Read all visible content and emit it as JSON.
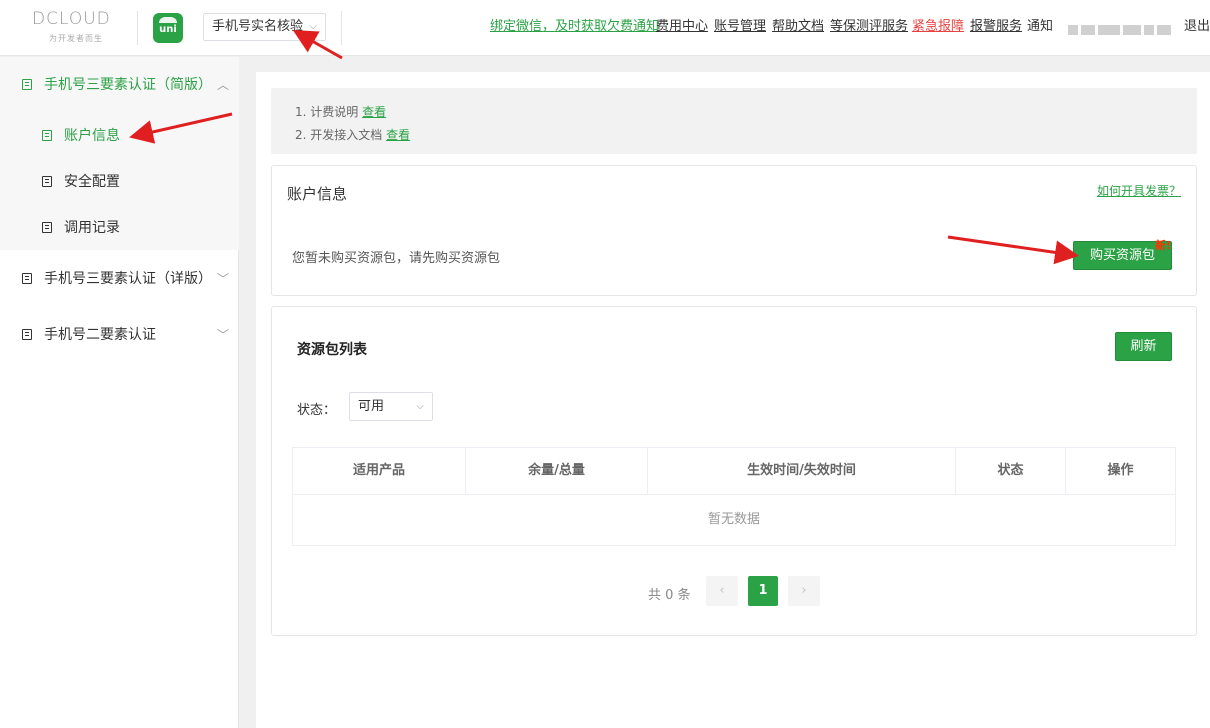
{
  "header": {
    "logo_text": "DCLOUD",
    "logo_sub": "为开发者而生",
    "uni_icon_label": "uni",
    "app_select": "手机号实名核验",
    "links": {
      "wechat": "绑定微信，及时获取欠费通知",
      "cost_center": "费用中心",
      "account_mgmt": "账号管理",
      "help_docs": "帮助文档",
      "security_eval": "等保测评服务",
      "emergency": "紧急报障",
      "alarm_service": "报警服务",
      "notice": "通知",
      "logout": "退出"
    }
  },
  "sidebar": {
    "groups": [
      {
        "label": "手机号三要素认证（简版）",
        "expanded": true,
        "items": [
          {
            "label": "账户信息",
            "active": true
          },
          {
            "label": "安全配置",
            "active": false
          },
          {
            "label": "调用记录",
            "active": false
          }
        ]
      },
      {
        "label": "手机号三要素认证（详版）",
        "expanded": false
      },
      {
        "label": "手机号二要素认证",
        "expanded": false
      }
    ]
  },
  "notice": {
    "line1_text": "1. 计费说明",
    "line1_link": "查看",
    "line2_text": "2. 开发接入文档",
    "line2_link": "查看"
  },
  "account_card": {
    "title": "账户信息",
    "invoice_link": "如何开具发票？",
    "message": "您暂未购买资源包，请先购买资源包",
    "buy_button": "购买资源包",
    "new_tag": "新!"
  },
  "list_card": {
    "title": "资源包列表",
    "refresh_button": "刷新",
    "status_label": "状态：",
    "status_value": "可用",
    "columns": [
      "适用产品",
      "余量/总量",
      "生效时间/失效时间",
      "状态",
      "操作"
    ],
    "empty_text": "暂无数据",
    "pager": {
      "total": "共 0 条",
      "prev": "‹",
      "current": "1",
      "next": "›"
    }
  },
  "colors": {
    "accent": "#2ba245",
    "danger": "#e64340",
    "arrow": "#e02020"
  }
}
